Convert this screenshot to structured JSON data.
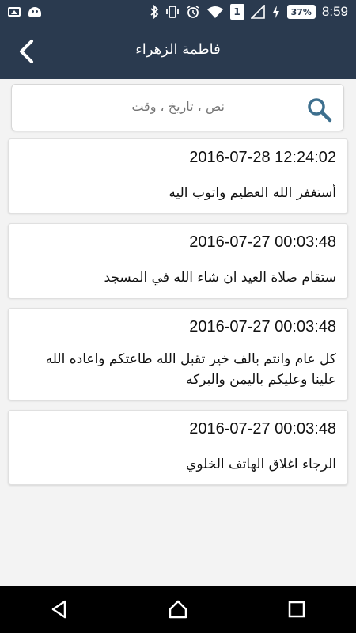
{
  "status_bar": {
    "battery": "37%",
    "sim_badge": "1",
    "time": "8:59",
    "icons": [
      "image-icon",
      "android-icon",
      "bluetooth-icon",
      "vibrate-icon",
      "alarm-icon",
      "wifi-icon",
      "sim-icon",
      "signal-icon",
      "charging-icon",
      "battery-icon"
    ]
  },
  "app_bar": {
    "title": "فاطمة الزهراء",
    "background_color": "#2a3a4f"
  },
  "search": {
    "placeholder": "نص ، تاريخ ، وقت",
    "icon_color": "#3d6f8e"
  },
  "messages": [
    {
      "datetime": "2016-07-28 12:24:02",
      "text": "أستغفر الله العظيم واتوب اليه"
    },
    {
      "datetime": "2016-07-27 00:03:48",
      "text": "ستقام صلاة العيد ان شاء الله في المسجد"
    },
    {
      "datetime": "2016-07-27 00:03:48",
      "text": "كل عام وانتم بالف خير تقبل الله طاعتكم واعاده الله علينا وعليكم باليمن والبركه"
    },
    {
      "datetime": "2016-07-27 00:03:48",
      "text": "الرجاء اغلاق الهاتف الخلوي"
    }
  ]
}
